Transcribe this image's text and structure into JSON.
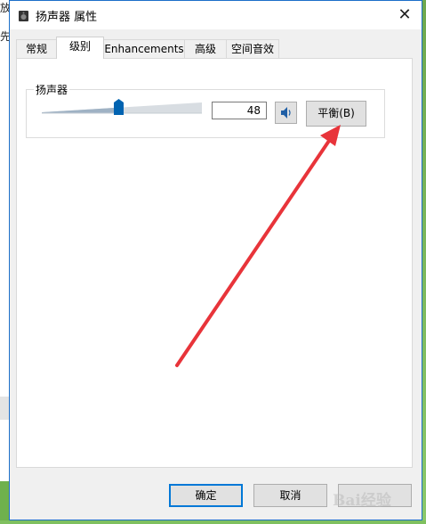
{
  "background": {
    "left_fragment_1": "放",
    "left_fragment_2": "先"
  },
  "window": {
    "title": "扬声器 属性",
    "close_glyph": "✕"
  },
  "tabs": [
    {
      "label": "常规",
      "active": false
    },
    {
      "label": "级别",
      "active": true
    },
    {
      "label": "Enhancements",
      "active": false
    },
    {
      "label": "高级",
      "active": false
    },
    {
      "label": "空间音效",
      "active": false
    }
  ],
  "levels": {
    "group_label": "扬声器",
    "volume_value": "48",
    "volume_level": 48,
    "mute_icon": "speaker-icon",
    "balance_label": "平衡(B)"
  },
  "buttons": {
    "ok": "确定",
    "cancel": "取消"
  },
  "watermark": {
    "text": "Bai经验"
  },
  "colors": {
    "accent": "#0078d7",
    "window_border": "#1c6fc9",
    "arrow": "#e8343a",
    "slider_thumb": "#0063b1"
  }
}
